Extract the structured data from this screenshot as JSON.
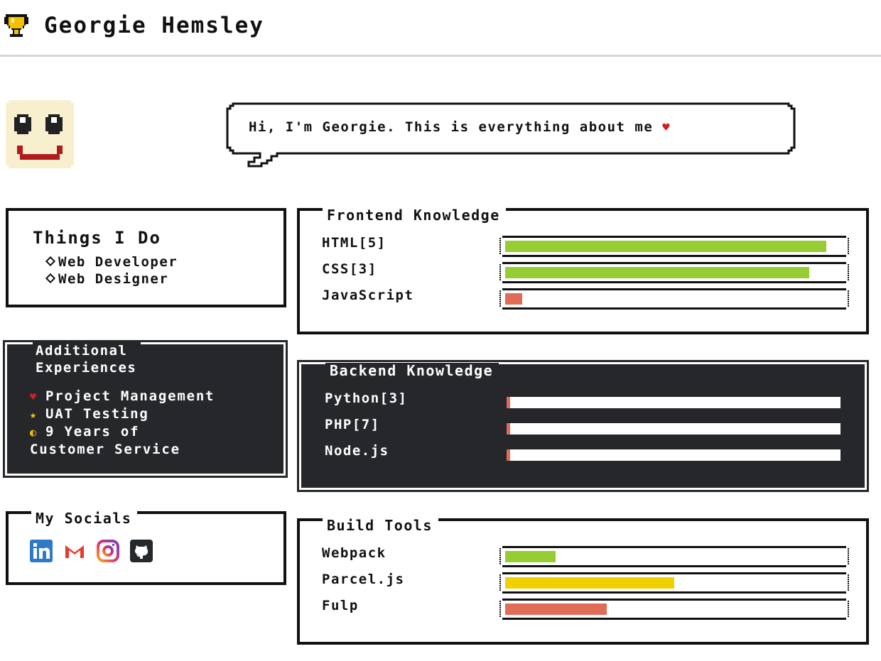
{
  "header": {
    "name": "Georgie Hemsley"
  },
  "speech": {
    "text": "Hi, I'm Georgie. This is everything about me",
    "heart": "♥"
  },
  "colors": {
    "green": "#97cd34",
    "yellow": "#f2d000",
    "red": "#e06c55",
    "dark": "#25272b",
    "heart": "#d11f1f"
  },
  "things_i_do": {
    "title": "Things I Do",
    "items": [
      "Web Developer",
      "Web Designer"
    ]
  },
  "additional": {
    "title_line1": "Additional",
    "title_line2": "Experiences",
    "items": [
      {
        "icon": "heart-icon",
        "glyph": "♥",
        "text": "Project Management"
      },
      {
        "icon": "star-icon",
        "glyph": "★",
        "text": "UAT Testing"
      },
      {
        "icon": "coin-icon",
        "glyph": "◐",
        "text": "9 Years of"
      }
    ],
    "continuation": "Customer Service"
  },
  "socials": {
    "title": "My Socials",
    "icons": [
      "linkedin-icon",
      "gmail-icon",
      "instagram-icon",
      "github-icon"
    ]
  },
  "frontend": {
    "title": "Frontend Knowledge",
    "skills": [
      {
        "label": "HTML[5]",
        "level": 0.95,
        "color": "#97cd34"
      },
      {
        "label": "CSS[3]",
        "level": 0.9,
        "color": "#97cd34"
      },
      {
        "label": "JavaScript",
        "level": 0.05,
        "color": "#e06c55"
      }
    ]
  },
  "backend": {
    "title": "Backend Knowledge",
    "skills": [
      {
        "label": "Python[3]",
        "level": 0.01,
        "color": "#e06c55"
      },
      {
        "label": "PHP[7]",
        "level": 0.01,
        "color": "#e06c55"
      },
      {
        "label": "Node.js",
        "level": 0.01,
        "color": "#e06c55"
      }
    ]
  },
  "build_tools": {
    "title": "Build Tools",
    "skills": [
      {
        "label": "Webpack",
        "level": 0.15,
        "color": "#97cd34"
      },
      {
        "label": "Parcel.js",
        "level": 0.5,
        "color": "#f2d000"
      },
      {
        "label": "Fulp",
        "level": 0.3,
        "color": "#e06c55"
      }
    ]
  }
}
